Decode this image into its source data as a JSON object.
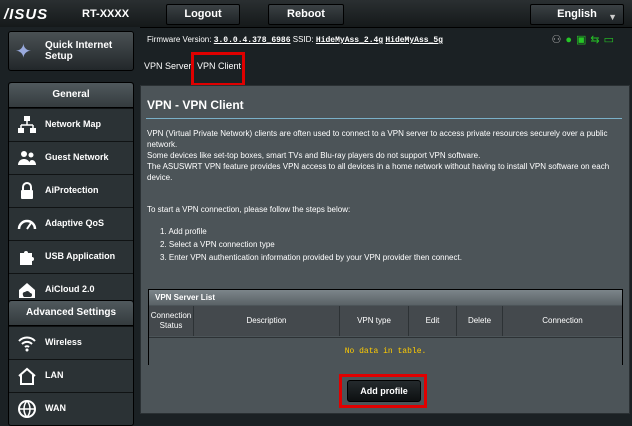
{
  "header": {
    "logo": "/ISUS",
    "model": "RT-XXXX",
    "logout_label": "Logout",
    "reboot_label": "Reboot",
    "language": "English"
  },
  "sidebar": {
    "quick_setup": "Quick Internet Setup",
    "general_header": "General",
    "general_items": [
      {
        "label": "Network Map",
        "icon": "network-map-icon"
      },
      {
        "label": "Guest Network",
        "icon": "guest-network-icon"
      },
      {
        "label": "AiProtection",
        "icon": "lock-icon"
      },
      {
        "label": "Adaptive QoS",
        "icon": "speedometer-icon"
      },
      {
        "label": "USB Application",
        "icon": "puzzle-icon"
      },
      {
        "label": "AiCloud 2.0",
        "icon": "cloud-house-icon"
      }
    ],
    "advanced_header": "Advanced Settings",
    "advanced_items": [
      {
        "label": "Wireless",
        "icon": "wifi-icon"
      },
      {
        "label": "LAN",
        "icon": "house-icon"
      },
      {
        "label": "WAN",
        "icon": "globe-icon"
      }
    ]
  },
  "status_bar": {
    "firmware_label": "Firmware Version:",
    "firmware_value": "3.0.0.4.378_6986",
    "ssid_label": "SSID:",
    "ssid_values": [
      "HideMyAss_2.4g",
      "HideMyAss_5g"
    ]
  },
  "tabs": [
    "VPN Server",
    "VPN Client"
  ],
  "content": {
    "title": "VPN - VPN Client",
    "paragraphs": [
      "VPN (Virtual Private Network) clients are often used to connect to a VPN server to access private resources securely over a public network.",
      "Some devices like set-top boxes, smart TVs and Blu-ray players do not support VPN software.",
      "The ASUSWRT VPN feature provides VPN access to all devices in a home network without having to install VPN software on each device."
    ],
    "steps_intro": "To start a VPN connection, please follow the steps below:",
    "steps": [
      "1.  Add profile",
      "2.  Select a VPN connection type",
      "3.  Enter VPN authentication information provided by your VPN provider then connect."
    ]
  },
  "vpn_table": {
    "title": "VPN Server List",
    "columns": [
      "Connection Status",
      "Description",
      "VPN type",
      "Edit",
      "Delete",
      "Connection"
    ],
    "empty_message": "No data in table."
  },
  "add_profile_label": "Add profile",
  "colors": {
    "highlight": "#e00000",
    "accent_green": "#26c626",
    "empty_text": "#ffcc00"
  }
}
